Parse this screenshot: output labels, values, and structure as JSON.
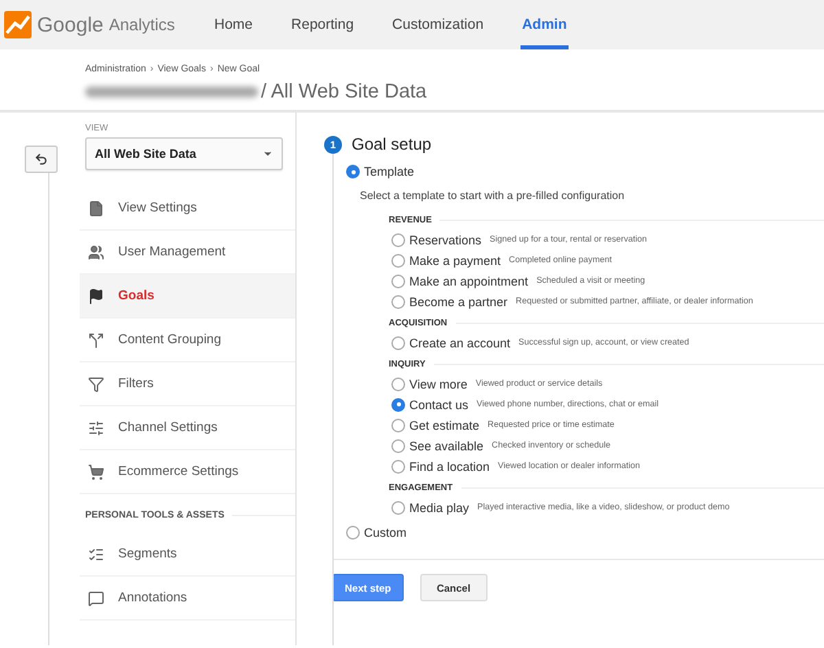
{
  "app": {
    "name": "Google",
    "product": "Analytics"
  },
  "nav": [
    {
      "label": "Home",
      "selected": false
    },
    {
      "label": "Reporting",
      "selected": false
    },
    {
      "label": "Customization",
      "selected": false
    },
    {
      "label": "Admin",
      "selected": true
    }
  ],
  "breadcrumb": {
    "separator": "›",
    "items": [
      "Administration",
      "View Goals",
      "New Goal"
    ]
  },
  "page_title": "/ All Web Site Data",
  "sidebar": {
    "view_label": "VIEW",
    "view_select": "All Web Site Data",
    "items": [
      {
        "label": "View Settings",
        "kind": "document",
        "selected": false
      },
      {
        "label": "User Management",
        "kind": "people",
        "selected": false
      },
      {
        "label": "Goals",
        "kind": "flag",
        "selected": true
      },
      {
        "label": "Content Grouping",
        "kind": "grouping",
        "selected": false
      },
      {
        "label": "Filters",
        "kind": "filter",
        "selected": false
      },
      {
        "label": "Channel Settings",
        "kind": "channel",
        "selected": false
      },
      {
        "label": "Ecommerce Settings",
        "kind": "cart",
        "selected": false
      }
    ],
    "section": "PERSONAL TOOLS & ASSETS",
    "section_items": [
      {
        "label": "Segments",
        "kind": "segments",
        "selected": false
      },
      {
        "label": "Annotations",
        "kind": "comment",
        "selected": false
      }
    ]
  },
  "step": {
    "number": "1",
    "title": "Goal setup"
  },
  "template": {
    "label": "Template",
    "selected": true,
    "description": "Select a template to start with a pre-filled configuration"
  },
  "groups": [
    {
      "name": "REVENUE",
      "options": [
        {
          "label": "Reservations",
          "description": "Signed up for a tour, rental or reservation",
          "selected": false
        },
        {
          "label": "Make a payment",
          "description": "Completed online payment",
          "selected": false
        },
        {
          "label": "Make an appointment",
          "description": "Scheduled a visit or meeting",
          "selected": false
        },
        {
          "label": "Become a partner",
          "description": "Requested or submitted partner, affiliate, or dealer information",
          "selected": false
        }
      ]
    },
    {
      "name": "ACQUISITION",
      "options": [
        {
          "label": "Create an account",
          "description": "Successful sign up, account, or view created",
          "selected": false
        }
      ]
    },
    {
      "name": "INQUIRY",
      "options": [
        {
          "label": "View more",
          "description": "Viewed product or service details",
          "selected": false
        },
        {
          "label": "Contact us",
          "description": "Viewed phone number, directions, chat or email",
          "selected": true
        },
        {
          "label": "Get estimate",
          "description": "Requested price or time estimate",
          "selected": false
        },
        {
          "label": "See available",
          "description": "Checked inventory or schedule",
          "selected": false
        },
        {
          "label": "Find a location",
          "description": "Viewed location or dealer information",
          "selected": false
        }
      ]
    },
    {
      "name": "ENGAGEMENT",
      "options": [
        {
          "label": "Media play",
          "description": "Played interactive media, like a video, slideshow, or product demo",
          "selected": false
        }
      ]
    }
  ],
  "custom": {
    "label": "Custom",
    "selected": false
  },
  "buttons": [
    {
      "label": "Next step",
      "kind": "primary"
    },
    {
      "label": "Cancel",
      "kind": "secondary"
    }
  ]
}
